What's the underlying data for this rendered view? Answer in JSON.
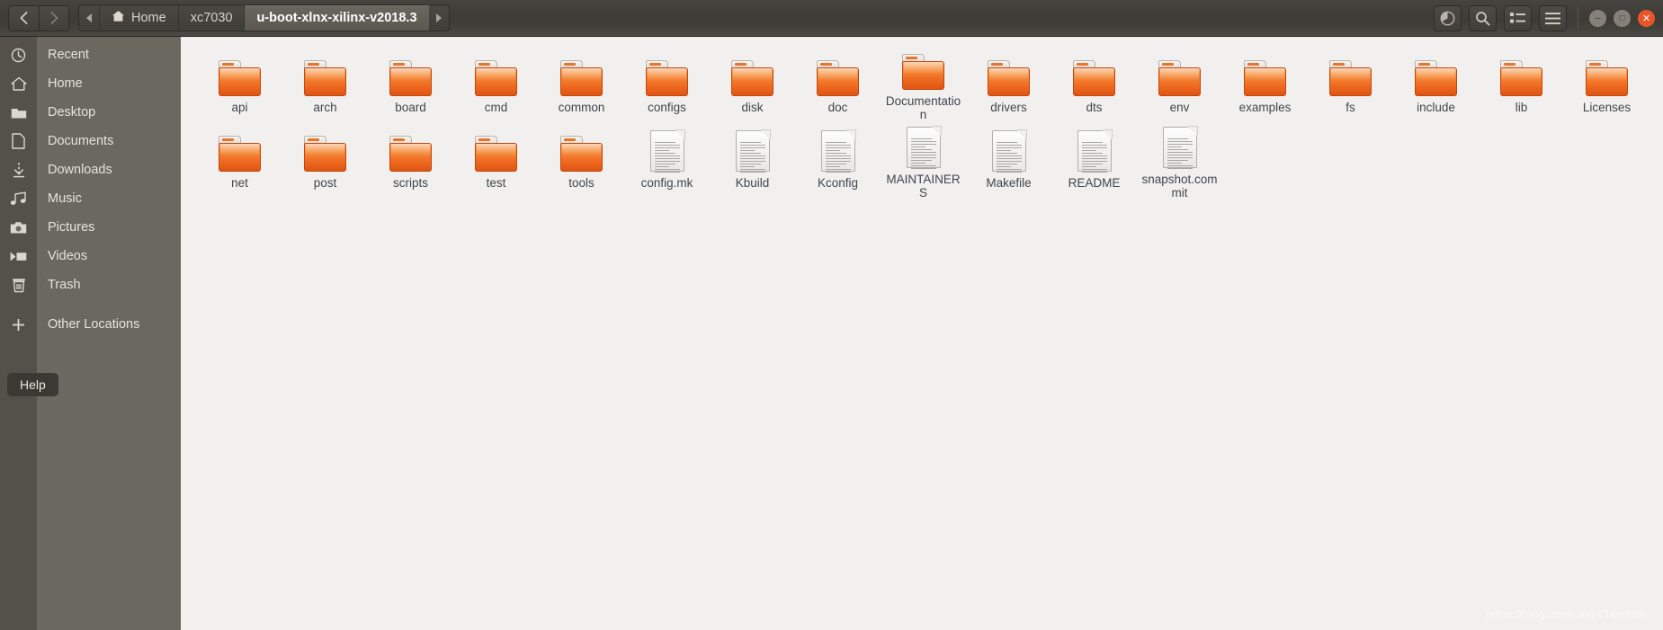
{
  "header": {
    "nav": {
      "back_label": "‹",
      "forward_label": "›"
    },
    "breadcrumb": {
      "scroll_left": "scroll-left",
      "scroll_right": "scroll-right",
      "items": [
        {
          "label": "Home",
          "icon": "home-icon",
          "active": false
        },
        {
          "label": "xc7030",
          "icon": "",
          "active": false
        },
        {
          "label": "u-boot-xlnx-xilinx-v2018.3",
          "icon": "",
          "active": true
        }
      ]
    },
    "buttons": [
      {
        "name": "progress-pie-button",
        "icon": "pie-progress-icon"
      },
      {
        "name": "search-button",
        "icon": "search-icon"
      },
      {
        "name": "view-list-button",
        "icon": "list-view-icon"
      },
      {
        "name": "menu-button",
        "icon": "hamburger-icon"
      }
    ],
    "window_controls": [
      {
        "name": "minimize-button",
        "glyph": "–"
      },
      {
        "name": "maximize-button",
        "glyph": "□"
      },
      {
        "name": "close-button",
        "glyph": "✕",
        "color": "#e8552b"
      }
    ]
  },
  "sidebar": {
    "items": [
      {
        "label": "Recent",
        "icon": "clock-icon"
      },
      {
        "label": "Home",
        "icon": "home-icon"
      },
      {
        "label": "Desktop",
        "icon": "folder-icon"
      },
      {
        "label": "Documents",
        "icon": "document-icon"
      },
      {
        "label": "Downloads",
        "icon": "download-icon"
      },
      {
        "label": "Music",
        "icon": "music-icon"
      },
      {
        "label": "Pictures",
        "icon": "camera-icon"
      },
      {
        "label": "Videos",
        "icon": "video-icon"
      },
      {
        "label": "Trash",
        "icon": "trash-icon"
      }
    ],
    "other": {
      "label": "Other Locations",
      "icon": "plus-icon"
    },
    "help_tooltip": "Help"
  },
  "main": {
    "files": [
      {
        "name": "api",
        "type": "folder"
      },
      {
        "name": "arch",
        "type": "folder"
      },
      {
        "name": "board",
        "type": "folder"
      },
      {
        "name": "cmd",
        "type": "folder"
      },
      {
        "name": "common",
        "type": "folder"
      },
      {
        "name": "configs",
        "type": "folder"
      },
      {
        "name": "disk",
        "type": "folder"
      },
      {
        "name": "doc",
        "type": "folder"
      },
      {
        "name": "Documentation",
        "type": "folder"
      },
      {
        "name": "drivers",
        "type": "folder"
      },
      {
        "name": "dts",
        "type": "folder"
      },
      {
        "name": "env",
        "type": "folder"
      },
      {
        "name": "examples",
        "type": "folder"
      },
      {
        "name": "fs",
        "type": "folder"
      },
      {
        "name": "include",
        "type": "folder"
      },
      {
        "name": "lib",
        "type": "folder"
      },
      {
        "name": "Licenses",
        "type": "folder"
      },
      {
        "name": "net",
        "type": "folder"
      },
      {
        "name": "post",
        "type": "folder"
      },
      {
        "name": "scripts",
        "type": "folder"
      },
      {
        "name": "test",
        "type": "folder"
      },
      {
        "name": "tools",
        "type": "folder"
      },
      {
        "name": "config.mk",
        "type": "file"
      },
      {
        "name": "Kbuild",
        "type": "file"
      },
      {
        "name": "Kconfig",
        "type": "file"
      },
      {
        "name": "MAINTAINERS",
        "type": "file"
      },
      {
        "name": "Makefile",
        "type": "file"
      },
      {
        "name": "README",
        "type": "file"
      },
      {
        "name": "snapshot.commit",
        "type": "file"
      }
    ]
  },
  "watermark": "https://blog.csdn.net/Claudedy",
  "colors": {
    "headerbar": "#3d3b36",
    "sidebar": "#6b6860",
    "icon_strip": "#54514a",
    "content_bg": "#f1f0ee",
    "folder_orange": "#ef6c22",
    "close_red": "#e8552b",
    "label_text": "#40464d"
  }
}
